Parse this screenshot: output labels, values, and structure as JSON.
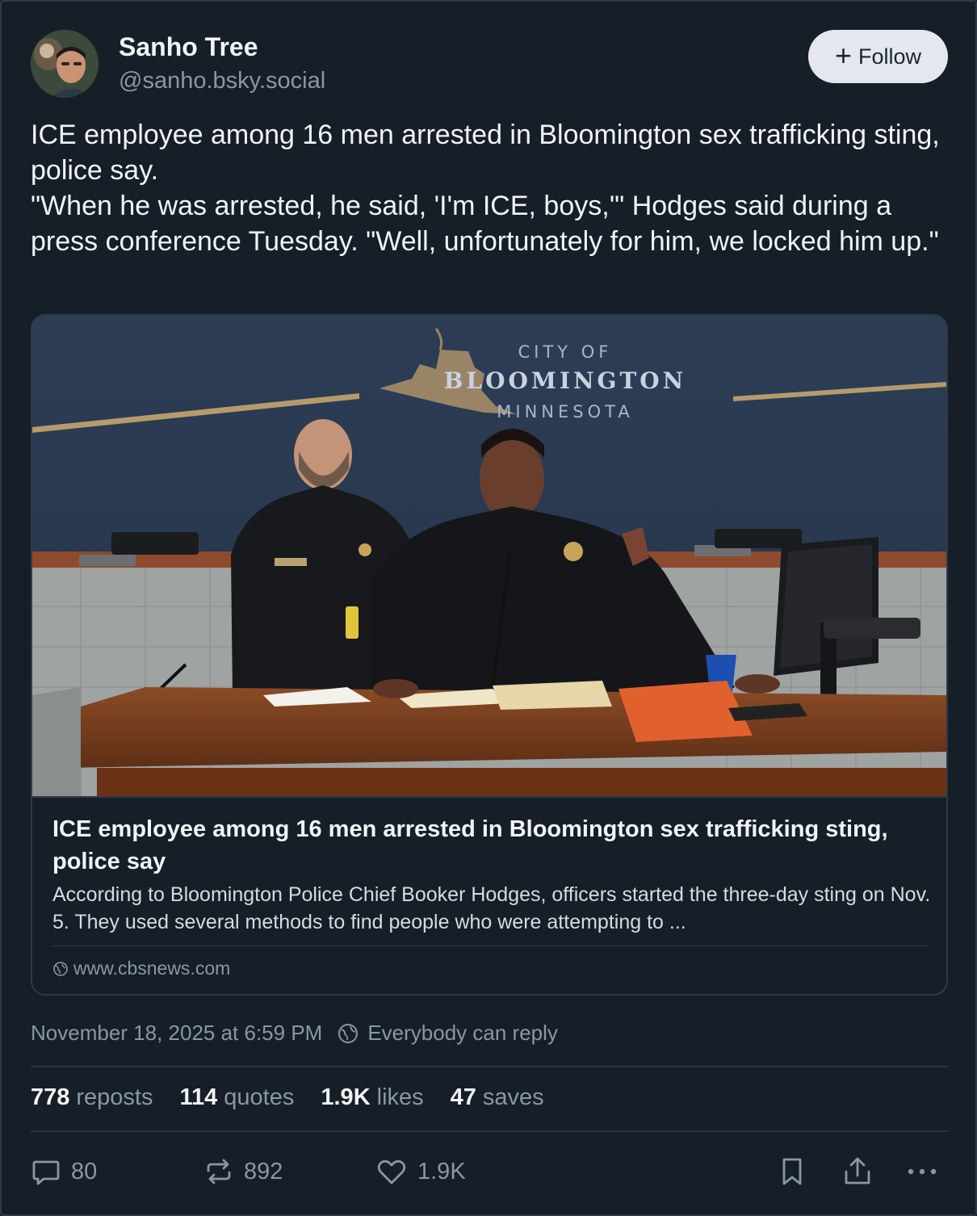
{
  "author": {
    "display_name": "Sanho Tree",
    "handle": "@sanho.bsky.social"
  },
  "follow_button": {
    "label": "Follow"
  },
  "post": {
    "paragraphs": [
      "ICE employee among 16 men arrested in Bloomington sex trafficking sting, police say.",
      "\"When he was arrested, he said, 'I'm ICE, boys,'\" Hodges said during a press conference Tuesday. \"Well, unfortunately for him, we locked him up.\""
    ]
  },
  "embed": {
    "image_sign": {
      "line1": "CITY OF",
      "line2": "BLOOMINGTON",
      "line3": "MINNESOTA"
    },
    "title": "ICE employee among 16 men arrested in Bloomington sex trafficking sting, police say",
    "description": "According to Bloomington Police Chief Booker Hodges, officers started the three-day sting on Nov. 5. They used several methods to find people who were attempting to ...",
    "domain": "www.cbsnews.com"
  },
  "meta": {
    "timestamp": "November 18, 2025 at 6:59 PM",
    "reply_setting": "Everybody can reply"
  },
  "stats": {
    "reposts": {
      "count": "778",
      "label": "reposts"
    },
    "quotes": {
      "count": "114",
      "label": "quotes"
    },
    "likes": {
      "count": "1.9K",
      "label": "likes"
    },
    "saves": {
      "count": "47",
      "label": "saves"
    }
  },
  "actions": {
    "reply_count": "80",
    "repost_count": "892",
    "like_count": "1.9K"
  },
  "colors": {
    "background": "#161e27",
    "text_primary": "#f1f3f5",
    "text_secondary": "#8a97a6",
    "border": "#2e3a48",
    "follow_bg": "#e4e8ee"
  }
}
